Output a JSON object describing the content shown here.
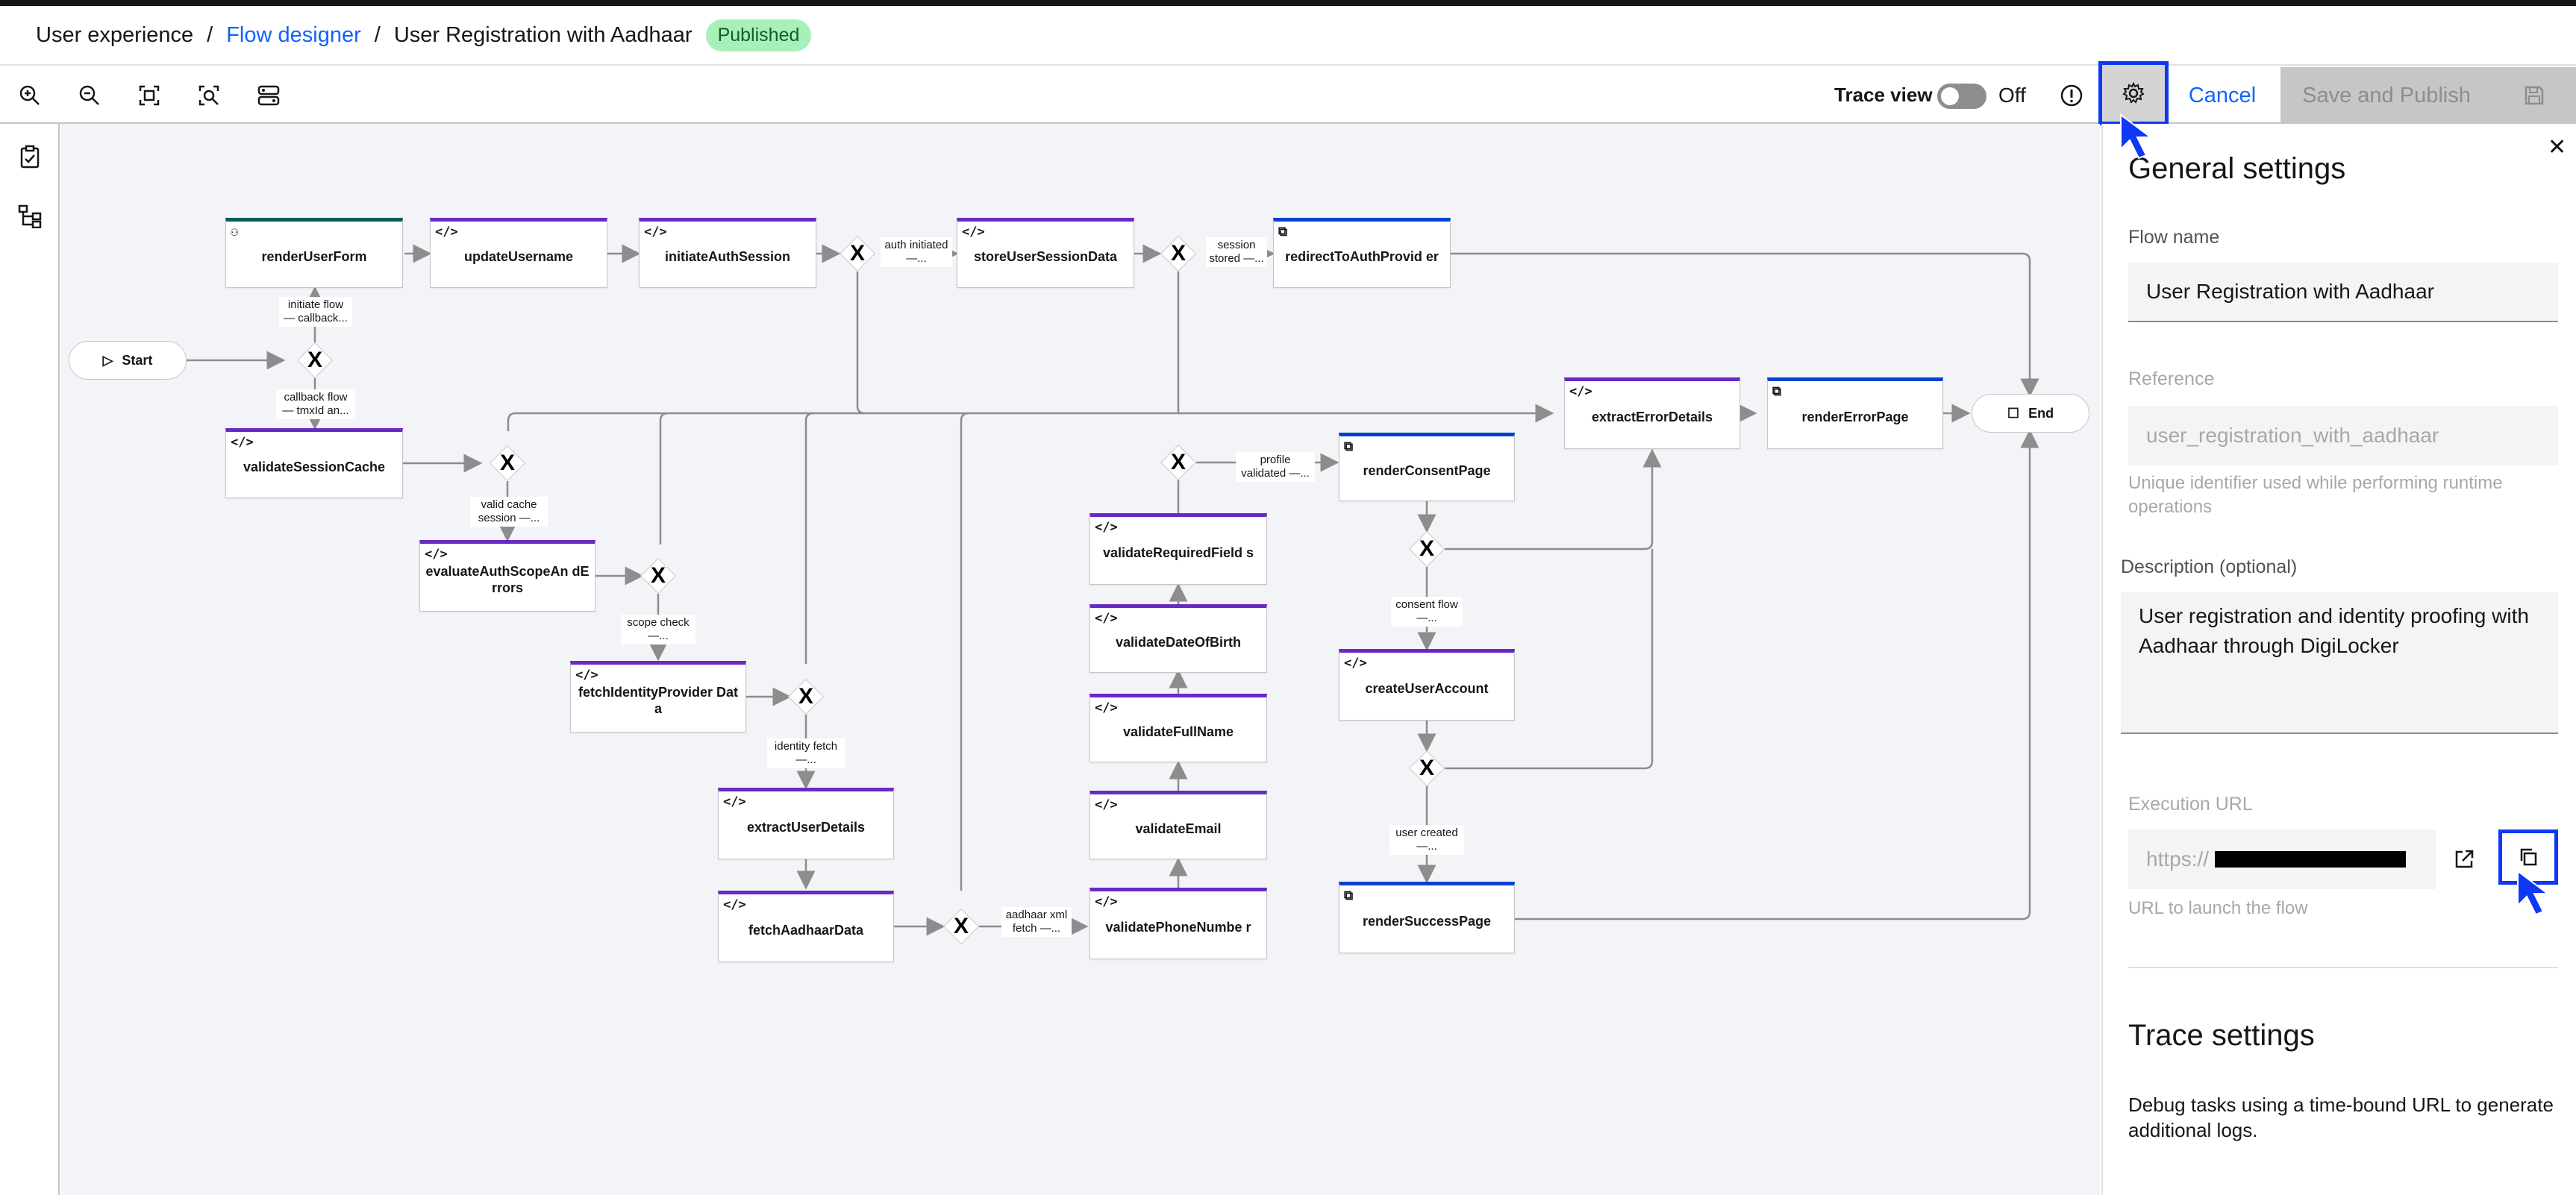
{
  "breadcrumb": {
    "root": "User experience",
    "separator": "/",
    "link": "Flow designer",
    "current": "User Registration with Aadhaar",
    "status_badge": "Published"
  },
  "toolbar": {
    "tools": [
      "zoom-in-icon",
      "zoom-out-icon",
      "fit-to-screen-icon",
      "zoom-area-icon",
      "auto-layout-icon"
    ],
    "trace_label": "Trace view",
    "trace_state": "Off",
    "trace_enabled": false,
    "cancel_label": "Cancel",
    "save_publish_label": "Save and Publish"
  },
  "left_rail": {
    "items": [
      "task-checklist-icon",
      "flow-tree-icon"
    ]
  },
  "flow": {
    "start_label": "Start",
    "end_label": "End",
    "gateway_symbol": "X",
    "nodes": {
      "renderUserForm": "renderUserForm",
      "updateUsername": "updateUsername",
      "initiateAuthSession": "initiateAuthSession",
      "storeUserSessionData": "storeUserSessionData",
      "redirectToAuthProvider": "redirectToAuthProvid er",
      "validateSessionCache": "validateSessionCache",
      "evaluateAuthScopeAndErrors": "evaluateAuthScopeAn dErrors",
      "fetchIdentityProviderData": "fetchIdentityProvider Data",
      "extractUserDetails": "extractUserDetails",
      "fetchAadhaarData": "fetchAadhaarData",
      "validateRequiredFields": "validateRequiredField s",
      "validateDateOfBirth": "validateDateOfBirth",
      "validateFullName": "validateFullName",
      "validateEmail": "validateEmail",
      "validatePhoneNumber": "validatePhoneNumbe r",
      "renderConsentPage": "renderConsentPage",
      "createUserAccount": "createUserAccount",
      "renderSuccessPage": "renderSuccessPage",
      "extractErrorDetails": "extractErrorDetails",
      "renderErrorPage": "renderErrorPage"
    },
    "edge_labels": {
      "initiate_flow": "initiate flow — callback...",
      "callback_flow": "callback flow — tmxId an...",
      "auth_initiated": "auth initiated —...",
      "session_stored": "session stored —...",
      "valid_cache": "valid cache session —...",
      "scope_check": "scope check —...",
      "identity_fetch": "identity fetch —...",
      "aadhaar_xml": "aadhaar xml fetch —...",
      "profile_validated": "profile validated —...",
      "consent_flow": "consent flow —...",
      "user_created": "user created —..."
    }
  },
  "panel": {
    "title": "General settings",
    "flow_name_label": "Flow name",
    "flow_name_value": "User Registration with Aadhaar",
    "reference_label": "Reference",
    "reference_value": "user_registration_with_aadhaar",
    "reference_help": "Unique identifier used while performing runtime operations",
    "description_label": "Description (optional)",
    "description_value": "User registration and identity proofing with Aadhaar through DigiLocker",
    "execution_url_label": "Execution URL",
    "execution_url_prefix": "https://",
    "execution_url_help": "URL to launch the flow",
    "trace_title": "Trace settings",
    "trace_description": "Debug tasks using a time-bound URL to generate additional logs."
  },
  "colors": {
    "accent": "#0f62fe",
    "highlight": "#0f38f5",
    "badge_bg": "#a7f0ba",
    "badge_text": "#0e6027",
    "node_purple": "#6929c4",
    "node_teal": "#005d5d",
    "node_blue": "#0043ce"
  }
}
